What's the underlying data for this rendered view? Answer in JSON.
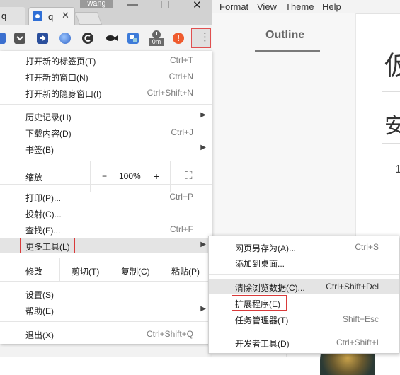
{
  "background_app": {
    "menubar": [
      "Format",
      "View",
      "Theme",
      "Help"
    ],
    "sidebar_tab": "Outline",
    "heading1_glyph": "仮",
    "heading2_glyph": "安",
    "number_text": "1"
  },
  "browser": {
    "tabs": [
      {
        "label": "q"
      },
      {
        "label": "q",
        "close": "✕"
      }
    ],
    "profile_name": "wang",
    "window_controls": [
      "—",
      "☐",
      "✕"
    ],
    "toolbar_icons": [
      "pocket-icon",
      "forward-icon",
      "globe-icon",
      "c-icon",
      "fish-icon",
      "puzzle-icon",
      "timer-icon",
      "alert-icon",
      "menu-icon"
    ],
    "timer_badge": "0m",
    "menu_button_glyph": "⋮"
  },
  "menu": {
    "items": [
      {
        "label": "打开新的标签页(T)",
        "shortcut": "Ctrl+T"
      },
      {
        "label": "打开新的窗口(N)",
        "shortcut": "Ctrl+N"
      },
      {
        "label": "打开新的隐身窗口(I)",
        "shortcut": "Ctrl+Shift+N"
      },
      {
        "label": "历史记录(H)",
        "shortcut": ""
      },
      {
        "label": "下载内容(D)",
        "shortcut": "Ctrl+J"
      },
      {
        "label": "书签(B)",
        "shortcut": ""
      },
      {
        "label": "打印(P)...",
        "shortcut": "Ctrl+P"
      },
      {
        "label": "投射(C)...",
        "shortcut": ""
      },
      {
        "label": "查找(F)...",
        "shortcut": "Ctrl+F"
      },
      {
        "label": "更多工具(L)",
        "shortcut": ""
      },
      {
        "label": "设置(S)",
        "shortcut": ""
      },
      {
        "label": "帮助(E)",
        "shortcut": ""
      },
      {
        "label": "退出(X)",
        "shortcut": "Ctrl+Shift+Q"
      }
    ],
    "zoom": {
      "label": "缩放",
      "minus": "−",
      "value": "100%",
      "plus": "+",
      "fullscreen": "⛶"
    },
    "edit": {
      "label": "修改",
      "cut": "剪切(T)",
      "copy": "复制(C)",
      "paste": "粘贴(P)"
    },
    "arrow": "▶"
  },
  "submenu": {
    "items": [
      {
        "label": "网页另存为(A)...",
        "shortcut": "Ctrl+S"
      },
      {
        "label": "添加到桌面...",
        "shortcut": ""
      },
      {
        "label": "清除浏览数据(C)...",
        "shortcut": "Ctrl+Shift+Del"
      },
      {
        "label": "扩展程序(E)",
        "shortcut": ""
      },
      {
        "label": "任务管理器(T)",
        "shortcut": "Shift+Esc"
      },
      {
        "label": "开发者工具(D)",
        "shortcut": "Ctrl+Shift+I"
      }
    ]
  },
  "colors": {
    "highlight_border": "#d93a3a",
    "hover_bg": "#e4e4e4"
  }
}
